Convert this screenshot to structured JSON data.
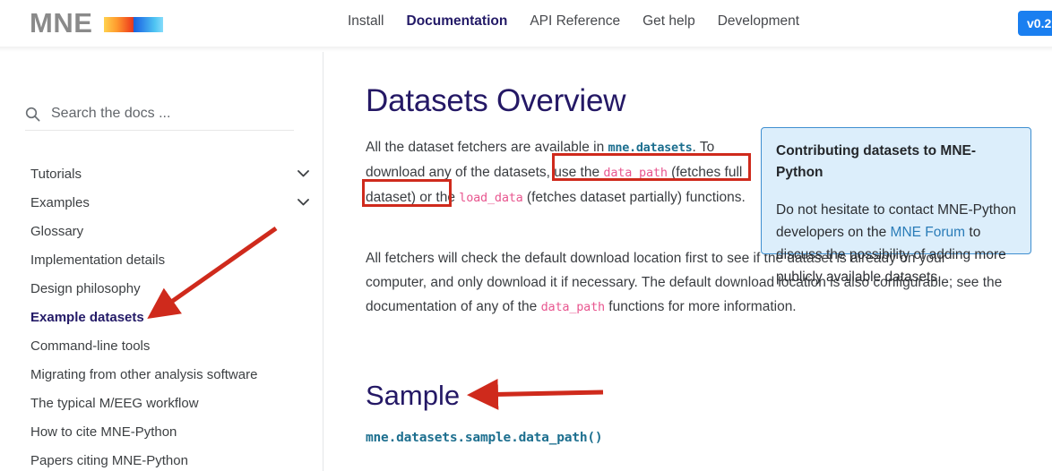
{
  "header": {
    "brand_text": "MNE",
    "brand_colorbar_name": "mne-colorbar-logo",
    "nav": [
      {
        "label": "Install",
        "active": false
      },
      {
        "label": "Documentation",
        "active": true
      },
      {
        "label": "API Reference",
        "active": false
      },
      {
        "label": "Get help",
        "active": false
      },
      {
        "label": "Development",
        "active": false
      }
    ],
    "version_badge": "v0.2"
  },
  "sidebar": {
    "search": {
      "placeholder": "Search the docs ...",
      "value": "",
      "icon": "search-icon"
    },
    "items": [
      {
        "label": "Tutorials",
        "expandable": true,
        "current": false
      },
      {
        "label": "Examples",
        "expandable": true,
        "current": false
      },
      {
        "label": "Glossary",
        "expandable": false,
        "current": false
      },
      {
        "label": "Implementation details",
        "expandable": false,
        "current": false
      },
      {
        "label": "Design philosophy",
        "expandable": false,
        "current": false
      },
      {
        "label": "Example datasets",
        "expandable": false,
        "current": true
      },
      {
        "label": "Command-line tools",
        "expandable": false,
        "current": false
      },
      {
        "label": "Migrating from other analysis software",
        "expandable": false,
        "current": false
      },
      {
        "label": "The typical M/EEG workflow",
        "expandable": false,
        "current": false
      },
      {
        "label": "How to cite MNE-Python",
        "expandable": false,
        "current": false
      },
      {
        "label": "Papers citing MNE-Python",
        "expandable": false,
        "current": false
      }
    ]
  },
  "main": {
    "page_title": "Datasets Overview",
    "paragraph1": {
      "t1": "All the dataset fetchers are available in ",
      "code1": "mne.datasets",
      "t2": ". To download any of the datasets, use the ",
      "code2": "data_path",
      "t3": " (fetches full dataset) or the ",
      "code3": "load_data",
      "t4": " (fetches dataset partially) functions."
    },
    "paragraph2": {
      "t1": "All fetchers will check the default download location first to see if the dataset is already on your computer, and only download it if necessary. The default download location is also configurable; see the documentation of any of the ",
      "code1": "data_path",
      "t2": " functions for more information."
    },
    "admonition": {
      "title": "Contributing datasets to MNE-Python",
      "body_before": "Do not hesitate to contact MNE-Python developers on the ",
      "link": "MNE Forum",
      "body_after": " to discuss the possibility of adding more publicly available datasets.",
      "accent_color": "#3f8fd0",
      "background_color": "#dceefb"
    },
    "section_title": "Sample",
    "sample_code": "mne.datasets.sample.data_path()"
  },
  "annotations": {
    "color": "#cf2a1c",
    "arrow_sidebar_name": "red-arrow-pointing-to-example-datasets",
    "arrow_section_name": "red-arrow-pointing-to-sample-heading",
    "box_labels": [
      "data_path-highlight-box",
      "full-dataset-highlight-box"
    ]
  }
}
